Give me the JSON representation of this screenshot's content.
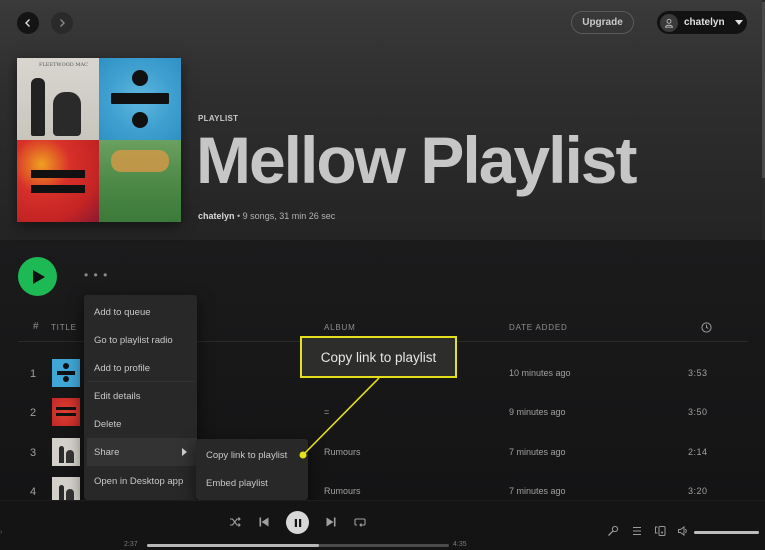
{
  "topbar": {
    "back_icon": "chevron-left-icon",
    "forward_icon": "chevron-right-icon",
    "upgrade_label": "Upgrade",
    "user_name": "chatelyn",
    "user_icon": "user-icon",
    "dropdown_icon": "caret-down-icon"
  },
  "playlist": {
    "type_label": "PLAYLIST",
    "title": "Mellow Playlist",
    "owner": "chatelyn",
    "separator": " • ",
    "summary": "9 songs, 31 min 26 sec",
    "cover_tiles": [
      "Rumours",
      "÷ (Divide)",
      "= (Equals)",
      "Smiley Smile"
    ]
  },
  "actions": {
    "play_icon": "play-icon",
    "more_label": "• • •"
  },
  "table": {
    "headers": {
      "num": "#",
      "title": "TITLE",
      "album": "ALBUM",
      "date_added": "DATE ADDED",
      "duration_icon": "clock-icon"
    },
    "rows": [
      {
        "num": "1",
        "album": "",
        "date_added": "10 minutes ago",
        "duration": "3:53",
        "art": "divide"
      },
      {
        "num": "2",
        "album": "=",
        "date_added": "9 minutes ago",
        "duration": "3:50",
        "art": "equals"
      },
      {
        "num": "3",
        "album": "Rumours",
        "date_added": "7 minutes ago",
        "duration": "2:14",
        "art": "rumours"
      },
      {
        "num": "4",
        "album": "Rumours",
        "date_added": "7 minutes ago",
        "duration": "3:20",
        "art": "rumours"
      }
    ]
  },
  "context_menu": {
    "items": [
      {
        "label": "Add to queue"
      },
      {
        "label": "Go to playlist radio"
      },
      {
        "label": "Add to profile"
      },
      {
        "label": "Edit details"
      },
      {
        "label": "Delete"
      },
      {
        "label": "Share",
        "has_submenu": true,
        "active": true
      },
      {
        "label": "Open in Desktop app"
      }
    ],
    "submenu": [
      {
        "label": "Copy link to playlist"
      },
      {
        "label": "Embed playlist"
      }
    ]
  },
  "callout": {
    "text": "Copy link to playlist",
    "color": "#e6e01c"
  },
  "player": {
    "elapsed": "2:37",
    "total": "4:35",
    "progress_fraction": 0.57,
    "volume_fraction": 1.0,
    "controls": [
      "shuffle-icon",
      "previous-icon",
      "pause-icon",
      "next-icon",
      "repeat-icon"
    ],
    "right_icons": [
      "lyrics-microphone-icon",
      "queue-icon",
      "devices-icon",
      "volume-icon"
    ]
  },
  "colors": {
    "accent_green": "#1db954",
    "callout_yellow": "#e6e01c"
  }
}
